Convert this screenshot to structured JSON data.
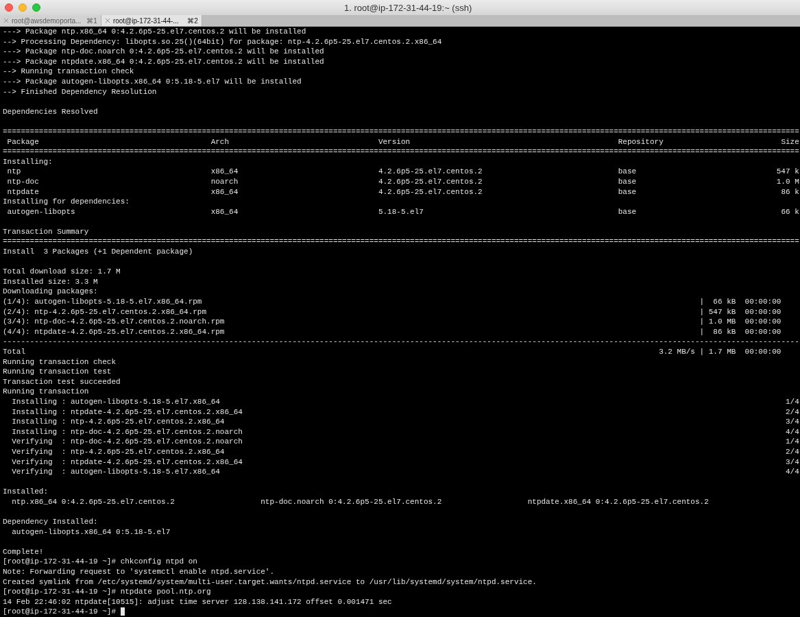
{
  "window": {
    "title": "1. root@ip-172-31-44-19:~ (ssh)"
  },
  "tabs": [
    {
      "label": "root@awsdemoporta...",
      "shortcut": "⌘1",
      "selected": false
    },
    {
      "label": "root@ip-172-31-44-...",
      "shortcut": "⌘2",
      "selected": true
    }
  ],
  "terminal": {
    "lines": [
      {
        "kind": "text",
        "text": "---> Package ntp.x86_64 0:4.2.6p5-25.el7.centos.2 will be installed"
      },
      {
        "kind": "text",
        "text": "--> Processing Dependency: libopts.so.25()(64bit) for package: ntp-4.2.6p5-25.el7.centos.2.x86_64"
      },
      {
        "kind": "text",
        "text": "---> Package ntp-doc.noarch 0:4.2.6p5-25.el7.centos.2 will be installed"
      },
      {
        "kind": "text",
        "text": "---> Package ntpdate.x86_64 0:4.2.6p5-25.el7.centos.2 will be installed"
      },
      {
        "kind": "text",
        "text": "--> Running transaction check"
      },
      {
        "kind": "text",
        "text": "---> Package autogen-libopts.x86_64 0:5.18-5.el7 will be installed"
      },
      {
        "kind": "text",
        "text": "--> Finished Dependency Resolution"
      },
      {
        "kind": "blank"
      },
      {
        "kind": "text",
        "text": "Dependencies Resolved"
      },
      {
        "kind": "blank"
      },
      {
        "kind": "rule",
        "text": "================================================================================================================================================================================"
      },
      {
        "kind": "table_header",
        "cells": [
          " Package",
          "Arch",
          "Version",
          "Repository",
          "Size"
        ]
      },
      {
        "kind": "rule",
        "text": "================================================================================================================================================================================"
      },
      {
        "kind": "text",
        "text": "Installing:"
      },
      {
        "kind": "table_row",
        "cells": [
          " ntp",
          "x86_64",
          "4.2.6p5-25.el7.centos.2",
          "base",
          "547 k"
        ]
      },
      {
        "kind": "table_row",
        "cells": [
          " ntp-doc",
          "noarch",
          "4.2.6p5-25.el7.centos.2",
          "base",
          "1.0 M"
        ]
      },
      {
        "kind": "table_row",
        "cells": [
          " ntpdate",
          "x86_64",
          "4.2.6p5-25.el7.centos.2",
          "base",
          "86 k"
        ]
      },
      {
        "kind": "text",
        "text": "Installing for dependencies:"
      },
      {
        "kind": "table_row",
        "cells": [
          " autogen-libopts",
          "x86_64",
          "5.18-5.el7",
          "base",
          "66 k"
        ]
      },
      {
        "kind": "blank"
      },
      {
        "kind": "text",
        "text": "Transaction Summary"
      },
      {
        "kind": "rule",
        "text": "================================================================================================================================================================================"
      },
      {
        "kind": "text",
        "text": "Install  3 Packages (+1 Dependent package)"
      },
      {
        "kind": "blank"
      },
      {
        "kind": "text",
        "text": "Total download size: 1.7 M"
      },
      {
        "kind": "text",
        "text": "Installed size: 3.3 M"
      },
      {
        "kind": "text",
        "text": "Downloading packages:"
      },
      {
        "kind": "download",
        "left": "(1/4): autogen-libopts-5.18-5.el7.x86_64.rpm",
        "right": "|  66 kB  00:00:00"
      },
      {
        "kind": "download",
        "left": "(2/4): ntp-4.2.6p5-25.el7.centos.2.x86_64.rpm",
        "right": "| 547 kB  00:00:00"
      },
      {
        "kind": "download",
        "left": "(3/4): ntp-doc-4.2.6p5-25.el7.centos.2.noarch.rpm",
        "right": "| 1.0 MB  00:00:00"
      },
      {
        "kind": "download",
        "left": "(4/4): ntpdate-4.2.6p5-25.el7.centos.2.x86_64.rpm",
        "right": "|  86 kB  00:00:00"
      },
      {
        "kind": "rule",
        "text": "--------------------------------------------------------------------------------------------------------------------------------------------------------------------------------"
      },
      {
        "kind": "download",
        "left": "Total",
        "right": "3.2 MB/s | 1.7 MB  00:00:00"
      },
      {
        "kind": "text",
        "text": "Running transaction check"
      },
      {
        "kind": "text",
        "text": "Running transaction test"
      },
      {
        "kind": "text",
        "text": "Transaction test succeeded"
      },
      {
        "kind": "text",
        "text": "Running transaction"
      },
      {
        "kind": "progress",
        "left": "  Installing : autogen-libopts-5.18-5.el7.x86_64",
        "right": "1/4"
      },
      {
        "kind": "progress",
        "left": "  Installing : ntpdate-4.2.6p5-25.el7.centos.2.x86_64",
        "right": "2/4"
      },
      {
        "kind": "progress",
        "left": "  Installing : ntp-4.2.6p5-25.el7.centos.2.x86_64",
        "right": "3/4"
      },
      {
        "kind": "progress",
        "left": "  Installing : ntp-doc-4.2.6p5-25.el7.centos.2.noarch",
        "right": "4/4"
      },
      {
        "kind": "progress",
        "left": "  Verifying  : ntp-doc-4.2.6p5-25.el7.centos.2.noarch",
        "right": "1/4"
      },
      {
        "kind": "progress",
        "left": "  Verifying  : ntp-4.2.6p5-25.el7.centos.2.x86_64",
        "right": "2/4"
      },
      {
        "kind": "progress",
        "left": "  Verifying  : ntpdate-4.2.6p5-25.el7.centos.2.x86_64",
        "right": "3/4"
      },
      {
        "kind": "progress",
        "left": "  Verifying  : autogen-libopts-5.18-5.el7.x86_64",
        "right": "4/4"
      },
      {
        "kind": "blank"
      },
      {
        "kind": "text",
        "text": "Installed:"
      },
      {
        "kind": "columns",
        "cells": [
          "  ntp.x86_64 0:4.2.6p5-25.el7.centos.2",
          "ntp-doc.noarch 0:4.2.6p5-25.el7.centos.2",
          "ntpdate.x86_64 0:4.2.6p5-25.el7.centos.2"
        ]
      },
      {
        "kind": "blank"
      },
      {
        "kind": "text",
        "text": "Dependency Installed:"
      },
      {
        "kind": "text",
        "text": "  autogen-libopts.x86_64 0:5.18-5.el7"
      },
      {
        "kind": "blank"
      },
      {
        "kind": "text",
        "text": "Complete!"
      },
      {
        "kind": "text",
        "text": "[root@ip-172-31-44-19 ~]# chkconfig ntpd on"
      },
      {
        "kind": "text",
        "text": "Note: Forwarding request to 'systemctl enable ntpd.service'."
      },
      {
        "kind": "text",
        "text": "Created symlink from /etc/systemd/system/multi-user.target.wants/ntpd.service to /usr/lib/systemd/system/ntpd.service."
      },
      {
        "kind": "text",
        "text": "[root@ip-172-31-44-19 ~]# ntpdate pool.ntp.org"
      },
      {
        "kind": "text",
        "text": "14 Feb 22:46:02 ntpdate[10515]: adjust time server 128.138.141.172 offset 0.001471 sec"
      },
      {
        "kind": "prompt",
        "text": "[root@ip-172-31-44-19 ~]#",
        "cursor": true
      }
    ]
  }
}
